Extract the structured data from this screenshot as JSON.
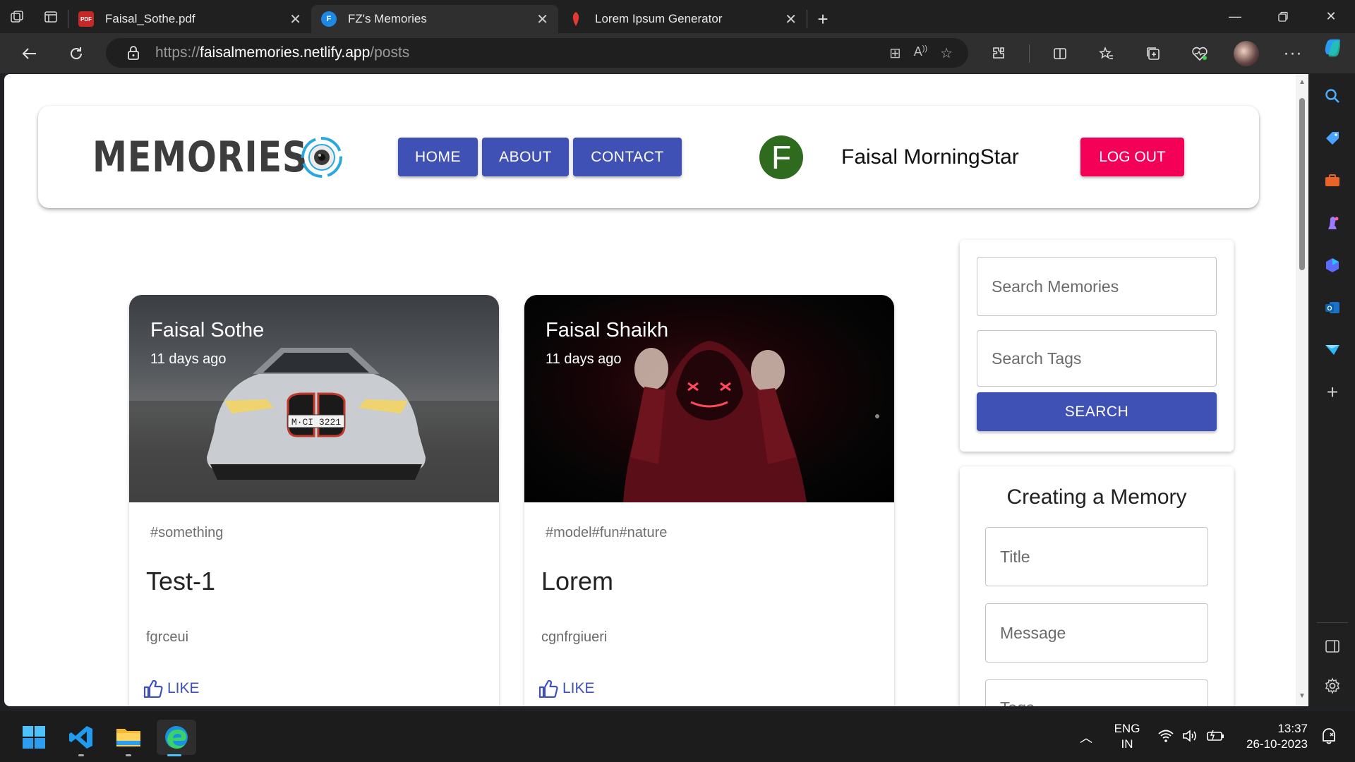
{
  "browser": {
    "tabs": [
      {
        "title": "Faisal_Sothe.pdf",
        "icon": "pdf-icon",
        "active": false
      },
      {
        "title": "FZ's Memories",
        "icon": "site-favicon-f",
        "active": true
      },
      {
        "title": "Lorem Ipsum Generator",
        "icon": "lorem-favicon",
        "active": false
      }
    ],
    "url": {
      "scheme": "https://",
      "host": "faisalmemories.netlify.app",
      "path": "/posts"
    }
  },
  "appbar": {
    "brand": "MEMORIES",
    "nav": [
      "HOME",
      "ABOUT",
      "CONTACT"
    ],
    "user_initial": "F",
    "user_name": "Faisal MorningStar",
    "logout_label": "LOG OUT"
  },
  "posts": [
    {
      "author": "Faisal Sothe",
      "time": "11 days ago",
      "tags": "#something",
      "title": "Test-1",
      "message": "fgrceui",
      "like_label": "LIKE",
      "plate": "M·CI 3221"
    },
    {
      "author": "Faisal Shaikh",
      "time": "11 days ago",
      "tags": "#model#fun#nature",
      "title": "Lorem",
      "message": "cgnfrgiueri",
      "like_label": "LIKE"
    }
  ],
  "search": {
    "memories_placeholder": "Search Memories",
    "tags_placeholder": "Search Tags",
    "button_label": "SEARCH"
  },
  "create": {
    "heading": "Creating a Memory",
    "title_placeholder": "Title",
    "message_placeholder": "Message",
    "tags_placeholder": "Tags"
  },
  "taskbar": {
    "lang": "ENG",
    "region": "IN",
    "time": "13:37",
    "date": "26-10-2023"
  },
  "colors": {
    "primary": "#3f51b5",
    "secondary": "#f50057",
    "avatar": "#2e6b1f"
  }
}
